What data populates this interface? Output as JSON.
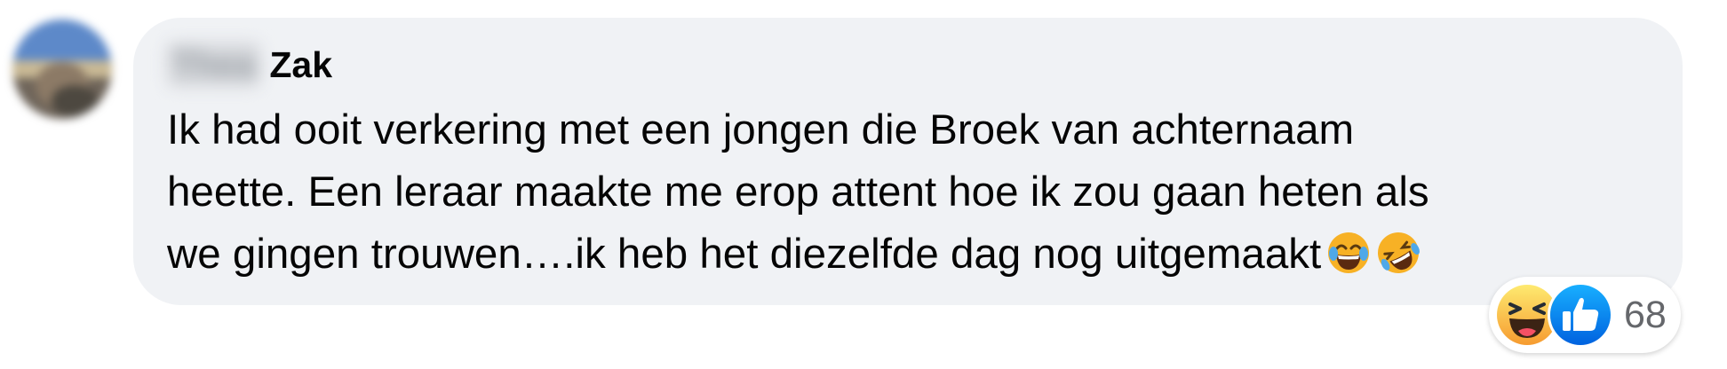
{
  "comment": {
    "author": {
      "first_name_redacted": "Thea",
      "last_name": "Zak"
    },
    "text_lines": [
      "Ik had ooit verkering met een jongen die Broek van achternaam",
      "heette. Een leraar maakte me erop attent hoe ik zou gaan heten als",
      "we gingen trouwen….ik heb het diezelfde dag nog uitgemaakt"
    ],
    "inline_emojis": [
      "joy-emoji",
      "rofl-emoji"
    ]
  },
  "reactions": {
    "icons": [
      "haha-reaction-icon",
      "like-reaction-icon"
    ],
    "count": "68"
  },
  "colors": {
    "bubble_bg": "#f0f2f5",
    "text": "#050505",
    "muted": "#65676b",
    "like_blue": "#1877f2",
    "emoji_yellow": "#f7b125"
  }
}
